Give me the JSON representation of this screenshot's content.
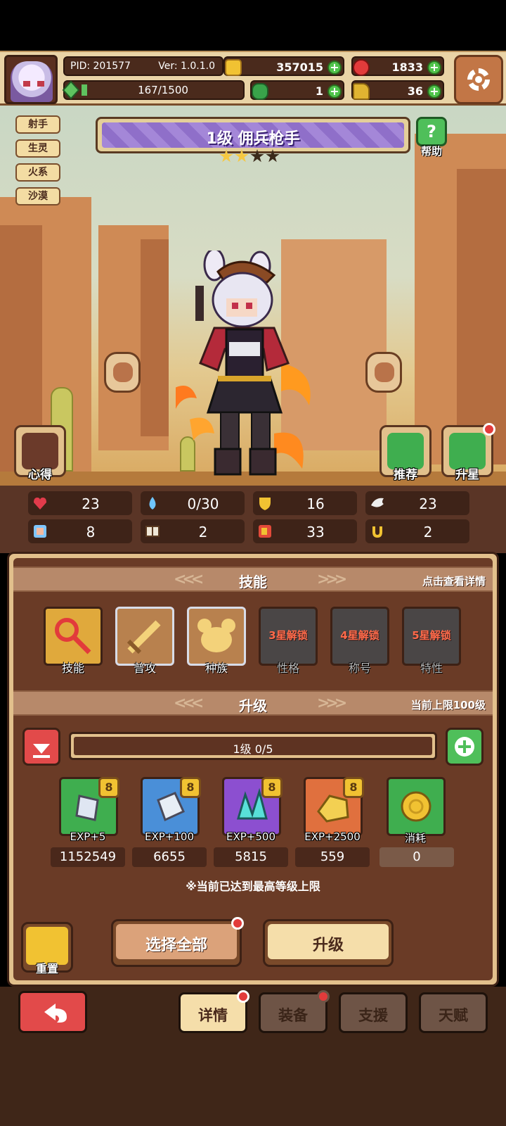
{
  "header": {
    "pid": "PID: 201577",
    "version": "Ver: 1.0.1.0",
    "exp_text": "167/1500",
    "gold": "357015",
    "gems": "1833",
    "clovers": "1",
    "boots": "36"
  },
  "tags": [
    "射手",
    "生灵",
    "火系",
    "沙漠"
  ],
  "hero": {
    "title": "1级  佣兵枪手",
    "stars_on": 2,
    "stars_total": 4
  },
  "buttons": {
    "help": "帮助",
    "notes": "心得",
    "recommend": "推荐",
    "star_up": "升星"
  },
  "stats": [
    "23",
    "0/30",
    "16",
    "23",
    "8",
    "2",
    "33",
    "2"
  ],
  "skills_section": {
    "title": "技能",
    "hint": "点击查看详情",
    "items": [
      {
        "label": "技能",
        "lock": ""
      },
      {
        "label": "普攻",
        "lock": ""
      },
      {
        "label": "种族",
        "lock": ""
      },
      {
        "label": "性格",
        "lock": "3星解锁"
      },
      {
        "label": "称号",
        "lock": "4星解锁"
      },
      {
        "label": "特性",
        "lock": "5星解锁"
      }
    ]
  },
  "upgrade_section": {
    "title": "升级",
    "hint": "当前上限100级",
    "level_text": "1级  0/5",
    "items": [
      {
        "label": "EXP+5",
        "badge": "8",
        "count": "1152549"
      },
      {
        "label": "EXP+100",
        "badge": "8",
        "count": "6655"
      },
      {
        "label": "EXP+500",
        "badge": "8",
        "count": "5815"
      },
      {
        "label": "EXP+2500",
        "badge": "8",
        "count": "559"
      },
      {
        "label": "消耗",
        "badge": "",
        "count": "0"
      }
    ],
    "notice": "※当前已达到最高等级上限"
  },
  "actions": {
    "reset": "重置",
    "select_all": "选择全部",
    "upgrade": "升级"
  },
  "tabs": [
    "详情",
    "装备",
    "支援",
    "天赋"
  ]
}
